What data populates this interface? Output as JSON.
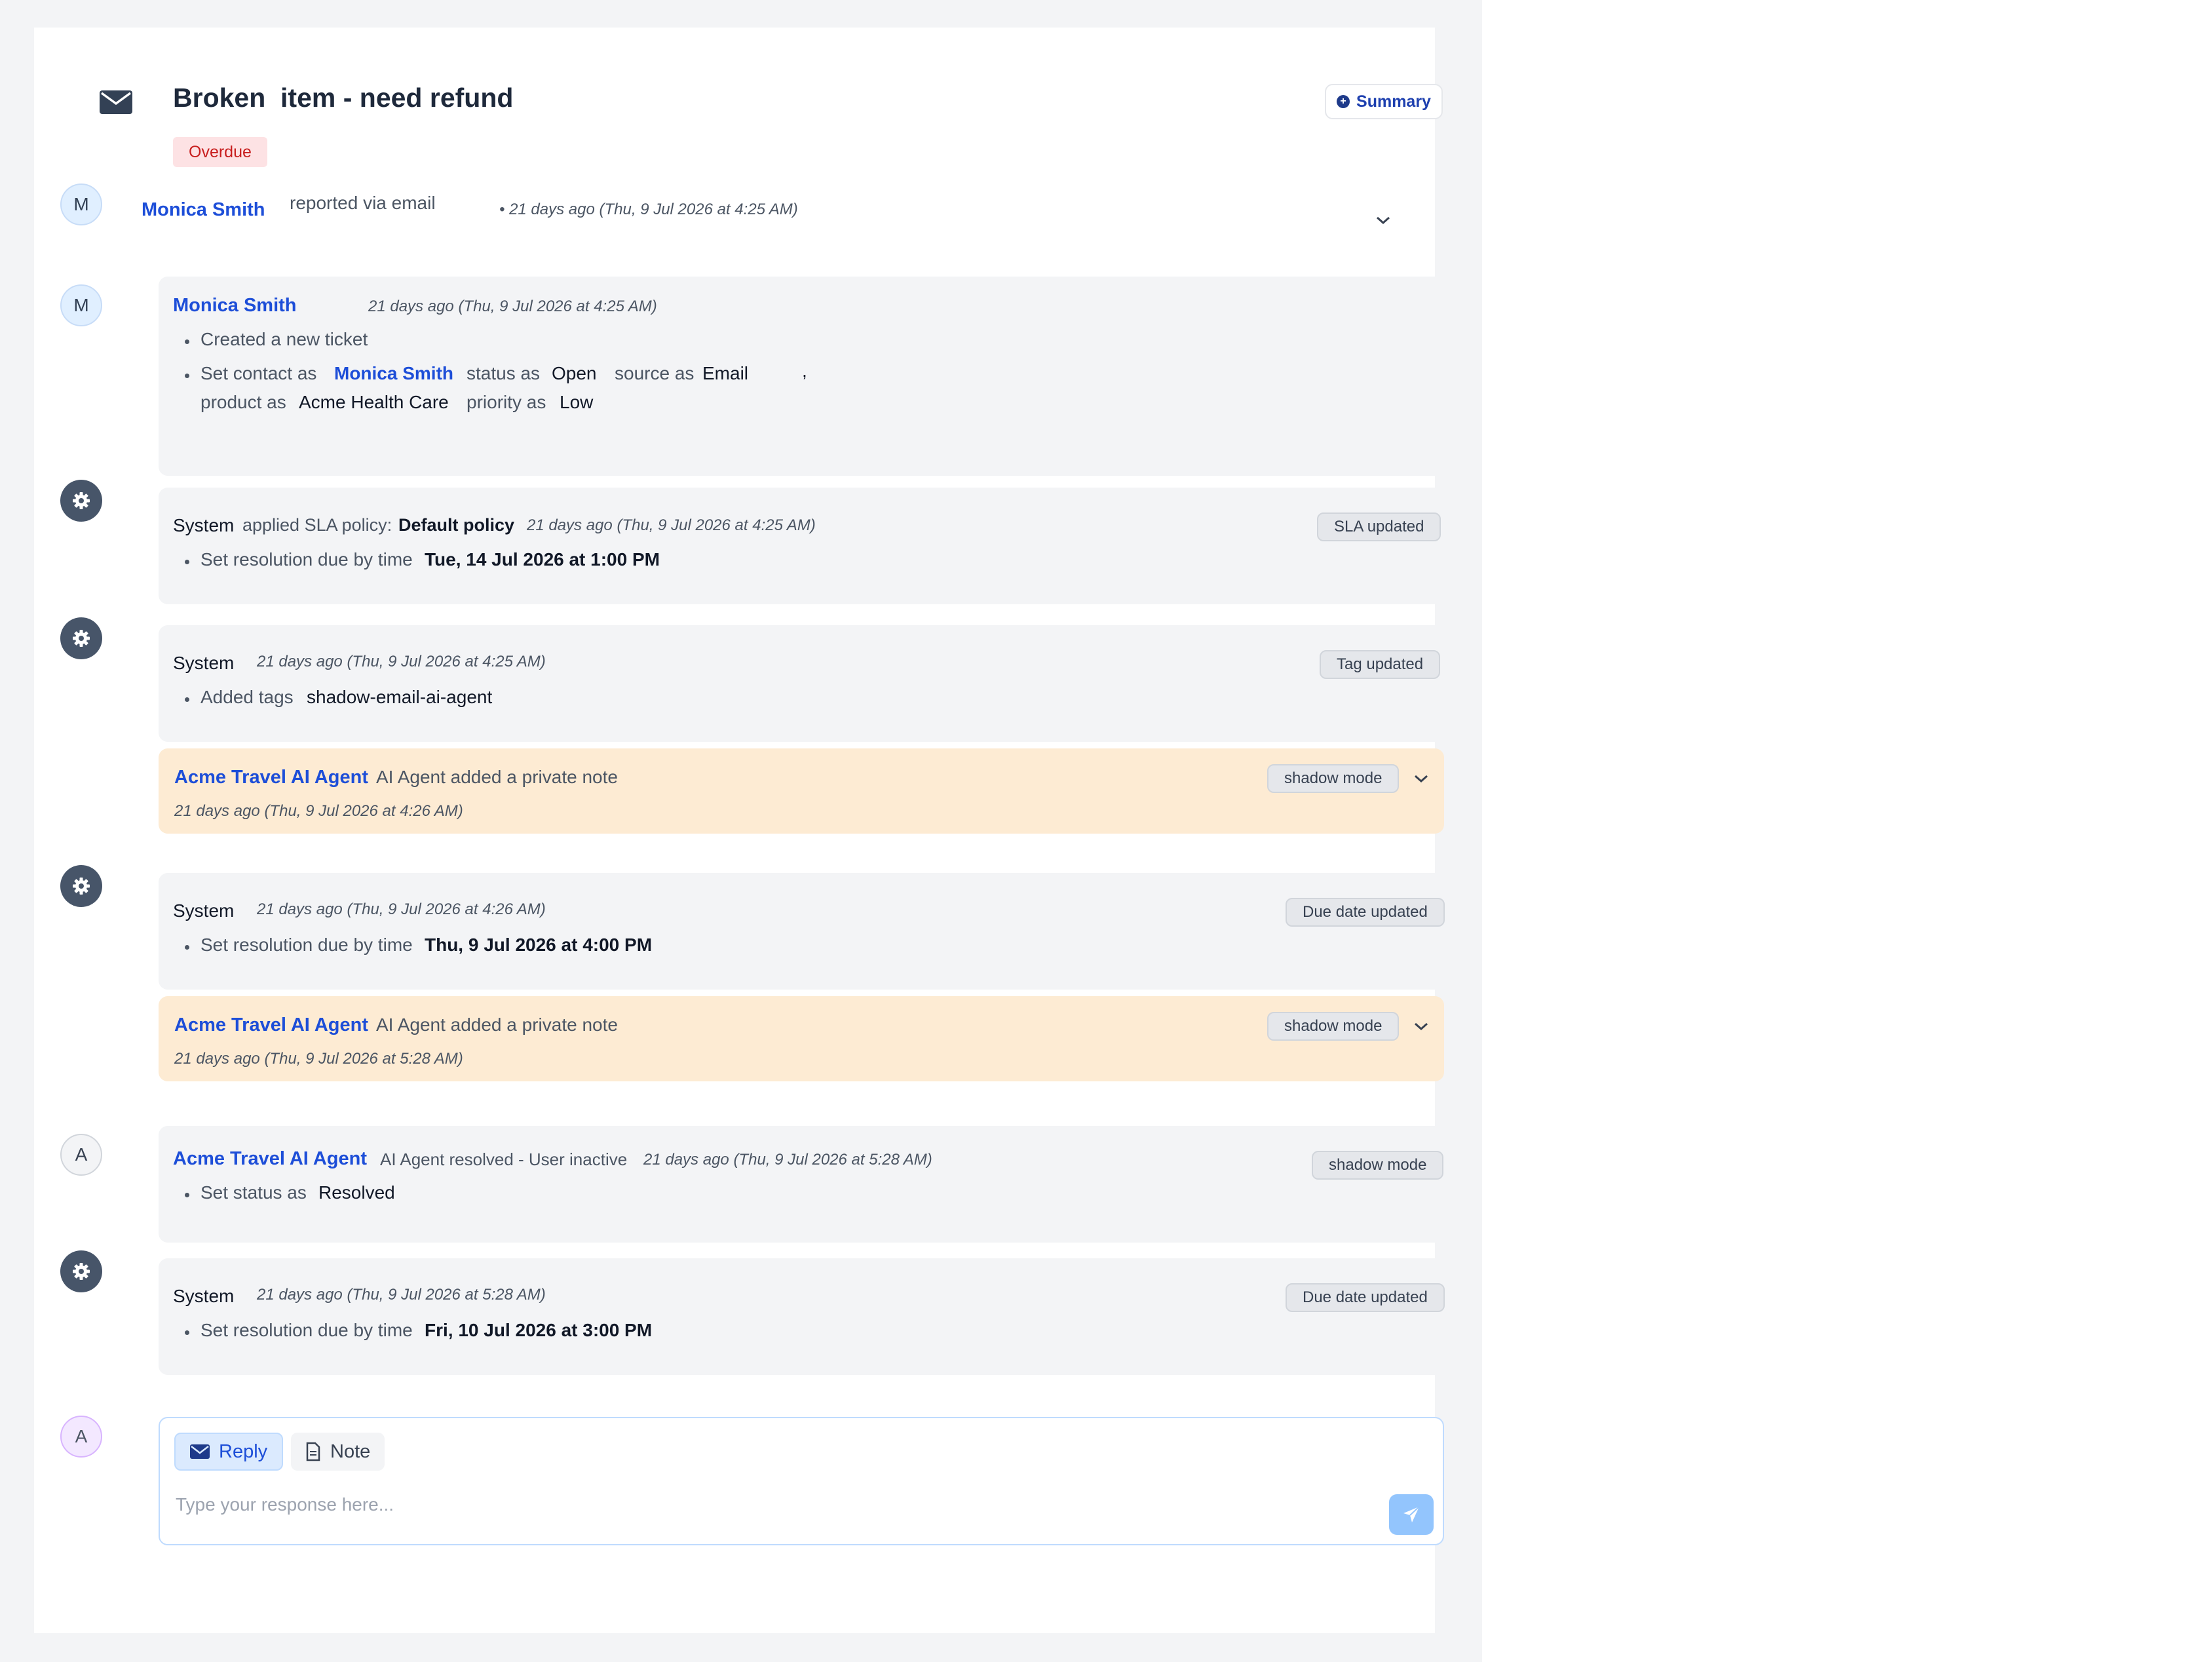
{
  "ticket": {
    "title": "Broken  item - need refund",
    "status_badge": "Overdue",
    "summary_label": "Summary"
  },
  "header_row": {
    "avatar_initial": "M",
    "name": "Monica Smith",
    "action": "reported via email",
    "timestamp": "• 21 days ago (Thu, 9 Jul 2026 at 4:25 AM)"
  },
  "activities": [
    {
      "avatar": "M",
      "actor": "Monica Smith",
      "timestamp": "21 days ago (Thu, 9 Jul 2026 at 4:25 AM)",
      "item1": "Created a new ticket",
      "item2": {
        "set_contact": "Set contact as",
        "contact": "Monica Smith",
        "status_label": "status as",
        "status": "Open",
        "source_label": "source as",
        "source": "Email",
        "comma": ",",
        "product_label": "product as",
        "product": "Acme Health Care",
        "priority_label": "priority as",
        "priority": "Low"
      }
    },
    {
      "actor": "System",
      "action": "applied SLA policy:",
      "policy": "Default policy",
      "timestamp": "21 days ago (Thu, 9 Jul 2026 at 4:25 AM)",
      "tag": "SLA updated",
      "item_label": "Set resolution due by time",
      "item_value": "Tue, 14 Jul 2026 at 1:00 PM"
    },
    {
      "actor": "System",
      "timestamp": "21 days ago (Thu, 9 Jul 2026 at 4:25 AM)",
      "tag": "Tag updated",
      "item_label": "Added tags",
      "item_value": "shadow-email-ai-agent"
    },
    {
      "actor": "Acme Travel AI Agent",
      "action": "AI Agent added a private note",
      "timestamp": "21 days ago (Thu, 9 Jul 2026 at 4:26 AM)",
      "tag": "shadow mode"
    },
    {
      "actor": "System",
      "timestamp": "21 days ago (Thu, 9 Jul 2026 at 4:26 AM)",
      "tag": "Due date updated",
      "item_label": "Set resolution due by time",
      "item_value": "Thu, 9 Jul 2026 at 4:00 PM"
    },
    {
      "actor": "Acme Travel AI Agent",
      "action": "AI Agent added a private note",
      "timestamp": "21 days ago (Thu, 9 Jul 2026 at 5:28 AM)",
      "tag": "shadow mode"
    },
    {
      "avatar": "A",
      "actor": "Acme Travel AI Agent",
      "action": "AI Agent resolved - User inactive",
      "timestamp": "21 days ago (Thu, 9 Jul 2026 at 5:28 AM)",
      "tag": "shadow mode",
      "item_label": "Set status as",
      "item_value": "Resolved"
    },
    {
      "actor": "System",
      "timestamp": "21 days ago (Thu, 9 Jul 2026 at 5:28 AM)",
      "tag": "Due date updated",
      "item_label": "Set resolution due by time",
      "item_value": "Fri, 10 Jul 2026 at 3:00 PM"
    }
  ],
  "composer": {
    "avatar": "A",
    "reply_label": "Reply",
    "note_label": "Note",
    "placeholder": "Type your response here..."
  },
  "colors": {
    "link": "#1d4ed8",
    "note_bg": "#fdebd3",
    "card_bg": "#f3f4f6",
    "overdue_bg": "#fde2e4",
    "overdue_text": "#c81e1e"
  }
}
